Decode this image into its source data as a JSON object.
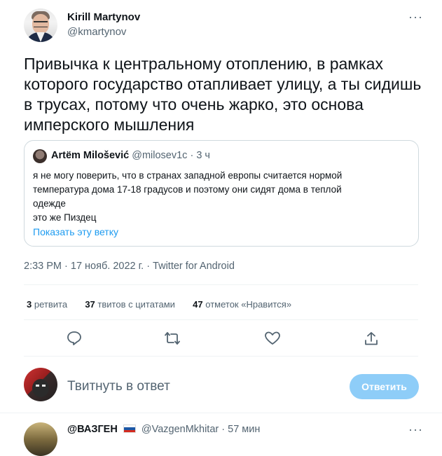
{
  "author": {
    "name": "Kirill Martynov",
    "handle": "@kmartynov"
  },
  "menu_icon_text": "···",
  "tweet": {
    "text": "Привычка к центральному отоплению, в рамках которого государство отапливает улицу, а ты сидишь в трусах, потому что очень жарко, это основа имперского мышления",
    "meta": "2:33 PM · 17 нояб. 2022 г. · Twitter for Android"
  },
  "quote": {
    "name": "Artëm Milošević",
    "handle": "@milosev1c",
    "time": "3 ч",
    "lines": [
      "я не могу поверить, что в странах западной европы считается нормой",
      "температура дома 17-18 градусов и поэтому они сидят дома в теплой",
      "одежде",
      "это же Пиздец"
    ],
    "show_thread": "Показать эту ветку"
  },
  "stats": {
    "retweets_count": "3",
    "retweets_label": "ретвита",
    "quotes_count": "37",
    "quotes_label": "твитов с цитатами",
    "likes_count": "47",
    "likes_label": "отметок «Нравится»"
  },
  "actions": {
    "reply_icon": "reply-icon",
    "retweet_icon": "retweet-icon",
    "like_icon": "heart-icon",
    "share_icon": "share-icon"
  },
  "reply_box": {
    "placeholder": "Твитнуть в ответ",
    "button": "Ответить"
  },
  "next_tweet": {
    "name": "@ВАЗГЕН",
    "handle": "@VazgenMkhitar",
    "time": "57 мин",
    "menu": "···"
  },
  "colors": {
    "accent": "#1d9bf0",
    "button_disabled": "#8ecdf8",
    "secondary_text": "#536471"
  }
}
